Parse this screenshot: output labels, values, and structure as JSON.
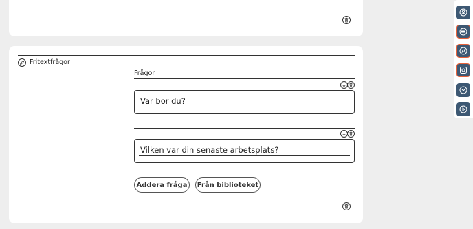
{
  "section": {
    "title": "Fritextfrågor",
    "questions_label": "Frågor"
  },
  "questions": [
    {
      "text": "Var bor du?"
    },
    {
      "text": "Vilken var din senaste arbetsplats?"
    }
  ],
  "buttons": {
    "add_question": "Addera fråga",
    "from_library": "Från biblioteket"
  },
  "icons": {
    "card_top_delete": "trash-icon",
    "section_icon": "pencil-icon",
    "question_move": "arrow-down-icon",
    "question_delete": "trash-icon",
    "sidebar": [
      "user-icon",
      "badge-icon",
      "compass-icon",
      "camera-icon",
      "chevron-down-icon",
      "play-icon"
    ]
  },
  "colors": {
    "sidebar_button": "#3d5873",
    "sidebar_highlight": "#e8623a",
    "background": "#eeeeee"
  }
}
